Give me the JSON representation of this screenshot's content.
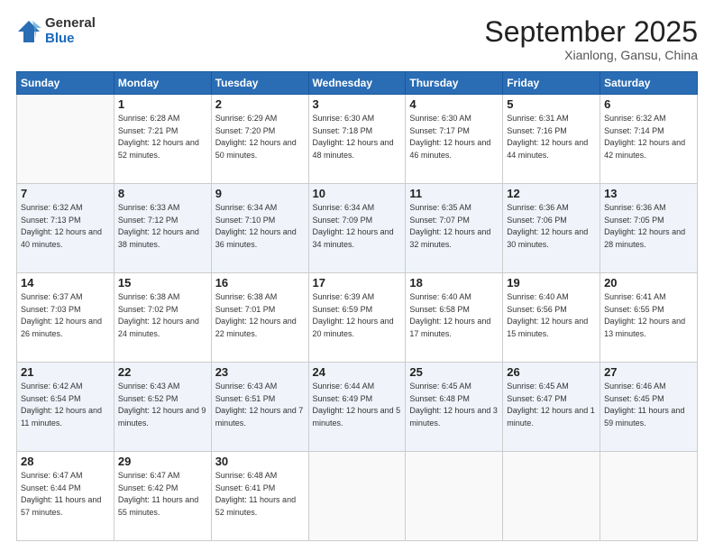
{
  "logo": {
    "general": "General",
    "blue": "Blue"
  },
  "header": {
    "month": "September 2025",
    "location": "Xianlong, Gansu, China"
  },
  "weekdays": [
    "Sunday",
    "Monday",
    "Tuesday",
    "Wednesday",
    "Thursday",
    "Friday",
    "Saturday"
  ],
  "weeks": [
    [
      {
        "day": "",
        "sunrise": "",
        "sunset": "",
        "daylight": ""
      },
      {
        "day": "1",
        "sunrise": "Sunrise: 6:28 AM",
        "sunset": "Sunset: 7:21 PM",
        "daylight": "Daylight: 12 hours and 52 minutes."
      },
      {
        "day": "2",
        "sunrise": "Sunrise: 6:29 AM",
        "sunset": "Sunset: 7:20 PM",
        "daylight": "Daylight: 12 hours and 50 minutes."
      },
      {
        "day": "3",
        "sunrise": "Sunrise: 6:30 AM",
        "sunset": "Sunset: 7:18 PM",
        "daylight": "Daylight: 12 hours and 48 minutes."
      },
      {
        "day": "4",
        "sunrise": "Sunrise: 6:30 AM",
        "sunset": "Sunset: 7:17 PM",
        "daylight": "Daylight: 12 hours and 46 minutes."
      },
      {
        "day": "5",
        "sunrise": "Sunrise: 6:31 AM",
        "sunset": "Sunset: 7:16 PM",
        "daylight": "Daylight: 12 hours and 44 minutes."
      },
      {
        "day": "6",
        "sunrise": "Sunrise: 6:32 AM",
        "sunset": "Sunset: 7:14 PM",
        "daylight": "Daylight: 12 hours and 42 minutes."
      }
    ],
    [
      {
        "day": "7",
        "sunrise": "Sunrise: 6:32 AM",
        "sunset": "Sunset: 7:13 PM",
        "daylight": "Daylight: 12 hours and 40 minutes."
      },
      {
        "day": "8",
        "sunrise": "Sunrise: 6:33 AM",
        "sunset": "Sunset: 7:12 PM",
        "daylight": "Daylight: 12 hours and 38 minutes."
      },
      {
        "day": "9",
        "sunrise": "Sunrise: 6:34 AM",
        "sunset": "Sunset: 7:10 PM",
        "daylight": "Daylight: 12 hours and 36 minutes."
      },
      {
        "day": "10",
        "sunrise": "Sunrise: 6:34 AM",
        "sunset": "Sunset: 7:09 PM",
        "daylight": "Daylight: 12 hours and 34 minutes."
      },
      {
        "day": "11",
        "sunrise": "Sunrise: 6:35 AM",
        "sunset": "Sunset: 7:07 PM",
        "daylight": "Daylight: 12 hours and 32 minutes."
      },
      {
        "day": "12",
        "sunrise": "Sunrise: 6:36 AM",
        "sunset": "Sunset: 7:06 PM",
        "daylight": "Daylight: 12 hours and 30 minutes."
      },
      {
        "day": "13",
        "sunrise": "Sunrise: 6:36 AM",
        "sunset": "Sunset: 7:05 PM",
        "daylight": "Daylight: 12 hours and 28 minutes."
      }
    ],
    [
      {
        "day": "14",
        "sunrise": "Sunrise: 6:37 AM",
        "sunset": "Sunset: 7:03 PM",
        "daylight": "Daylight: 12 hours and 26 minutes."
      },
      {
        "day": "15",
        "sunrise": "Sunrise: 6:38 AM",
        "sunset": "Sunset: 7:02 PM",
        "daylight": "Daylight: 12 hours and 24 minutes."
      },
      {
        "day": "16",
        "sunrise": "Sunrise: 6:38 AM",
        "sunset": "Sunset: 7:01 PM",
        "daylight": "Daylight: 12 hours and 22 minutes."
      },
      {
        "day": "17",
        "sunrise": "Sunrise: 6:39 AM",
        "sunset": "Sunset: 6:59 PM",
        "daylight": "Daylight: 12 hours and 20 minutes."
      },
      {
        "day": "18",
        "sunrise": "Sunrise: 6:40 AM",
        "sunset": "Sunset: 6:58 PM",
        "daylight": "Daylight: 12 hours and 17 minutes."
      },
      {
        "day": "19",
        "sunrise": "Sunrise: 6:40 AM",
        "sunset": "Sunset: 6:56 PM",
        "daylight": "Daylight: 12 hours and 15 minutes."
      },
      {
        "day": "20",
        "sunrise": "Sunrise: 6:41 AM",
        "sunset": "Sunset: 6:55 PM",
        "daylight": "Daylight: 12 hours and 13 minutes."
      }
    ],
    [
      {
        "day": "21",
        "sunrise": "Sunrise: 6:42 AM",
        "sunset": "Sunset: 6:54 PM",
        "daylight": "Daylight: 12 hours and 11 minutes."
      },
      {
        "day": "22",
        "sunrise": "Sunrise: 6:43 AM",
        "sunset": "Sunset: 6:52 PM",
        "daylight": "Daylight: 12 hours and 9 minutes."
      },
      {
        "day": "23",
        "sunrise": "Sunrise: 6:43 AM",
        "sunset": "Sunset: 6:51 PM",
        "daylight": "Daylight: 12 hours and 7 minutes."
      },
      {
        "day": "24",
        "sunrise": "Sunrise: 6:44 AM",
        "sunset": "Sunset: 6:49 PM",
        "daylight": "Daylight: 12 hours and 5 minutes."
      },
      {
        "day": "25",
        "sunrise": "Sunrise: 6:45 AM",
        "sunset": "Sunset: 6:48 PM",
        "daylight": "Daylight: 12 hours and 3 minutes."
      },
      {
        "day": "26",
        "sunrise": "Sunrise: 6:45 AM",
        "sunset": "Sunset: 6:47 PM",
        "daylight": "Daylight: 12 hours and 1 minute."
      },
      {
        "day": "27",
        "sunrise": "Sunrise: 6:46 AM",
        "sunset": "Sunset: 6:45 PM",
        "daylight": "Daylight: 11 hours and 59 minutes."
      }
    ],
    [
      {
        "day": "28",
        "sunrise": "Sunrise: 6:47 AM",
        "sunset": "Sunset: 6:44 PM",
        "daylight": "Daylight: 11 hours and 57 minutes."
      },
      {
        "day": "29",
        "sunrise": "Sunrise: 6:47 AM",
        "sunset": "Sunset: 6:42 PM",
        "daylight": "Daylight: 11 hours and 55 minutes."
      },
      {
        "day": "30",
        "sunrise": "Sunrise: 6:48 AM",
        "sunset": "Sunset: 6:41 PM",
        "daylight": "Daylight: 11 hours and 52 minutes."
      },
      {
        "day": "",
        "sunrise": "",
        "sunset": "",
        "daylight": ""
      },
      {
        "day": "",
        "sunrise": "",
        "sunset": "",
        "daylight": ""
      },
      {
        "day": "",
        "sunrise": "",
        "sunset": "",
        "daylight": ""
      },
      {
        "day": "",
        "sunrise": "",
        "sunset": "",
        "daylight": ""
      }
    ]
  ]
}
